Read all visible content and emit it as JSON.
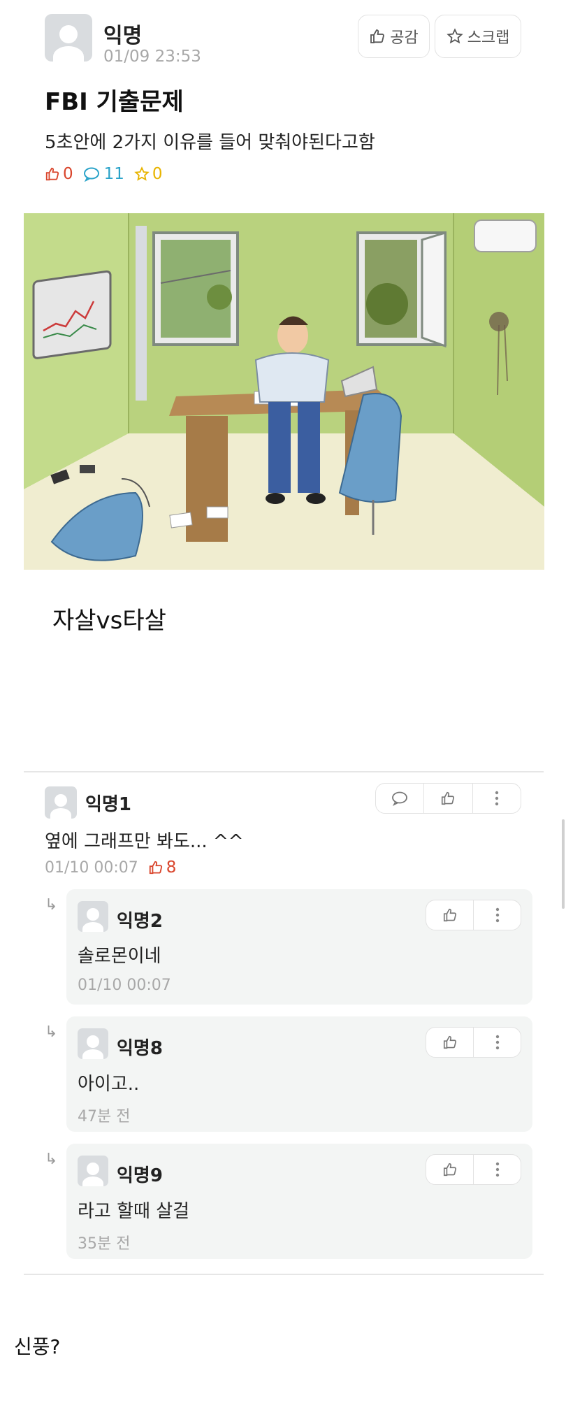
{
  "post": {
    "author": "익명",
    "time": "01/09 23:53",
    "btn_like": "공감",
    "btn_scrap": "스크랩",
    "title": "FBI 기출문제",
    "body": "5초안에 2가지 이유를 들어 맞춰야된다고함",
    "likes": "0",
    "comments": "11",
    "scraps": "0",
    "caption": "자살vs타살",
    "colors": {
      "like": "#d9452c",
      "comment": "#2aa3c9",
      "scrap": "#e8b400"
    }
  },
  "comments": [
    {
      "author": "익명1",
      "text": "옆에 그래프만 봐도... ^^",
      "time": "01/10 00:07",
      "likes": "8"
    }
  ],
  "replies": [
    {
      "author": "익명2",
      "text": "솔로몬이네",
      "time": "01/10 00:07"
    },
    {
      "author": "익명8",
      "text": "아이고..",
      "time": "47분 전"
    },
    {
      "author": "익명9",
      "text": "라고 할때 살걸",
      "time": "35분 전"
    }
  ],
  "footer_text": "신풍?"
}
